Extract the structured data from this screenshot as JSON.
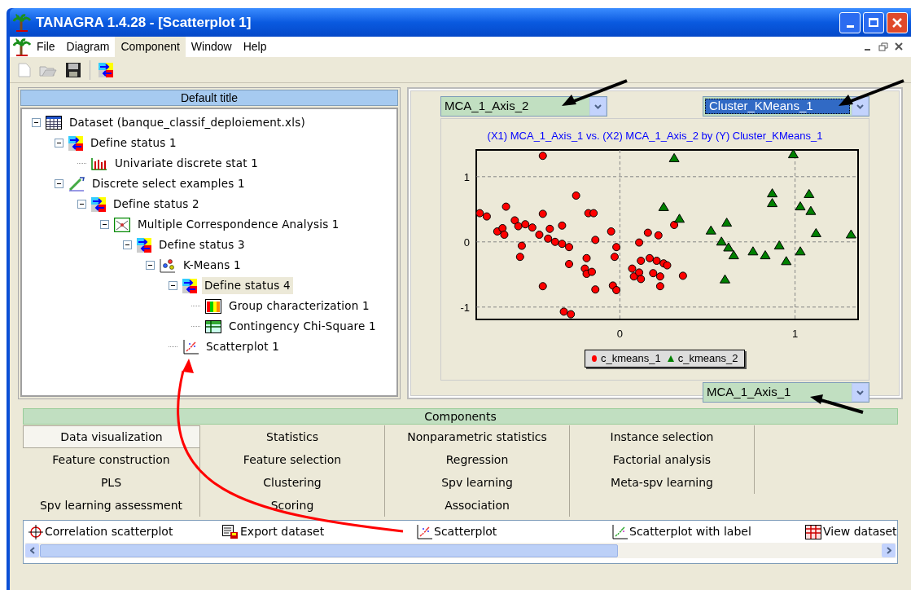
{
  "window": {
    "title": "TANAGRA 1.4.28 - [Scatterplot 1]"
  },
  "menu": [
    {
      "label": "File",
      "selected": false
    },
    {
      "label": "Diagram",
      "selected": false
    },
    {
      "label": "Component",
      "selected": true
    },
    {
      "label": "Window",
      "selected": false
    },
    {
      "label": "Help",
      "selected": false
    }
  ],
  "diagram": {
    "title": "Default title",
    "tree": [
      {
        "label": "Dataset (banque_classif_deploiement.xls)",
        "kind": "table",
        "expanded": true,
        "selected": false,
        "children": [
          {
            "label": "Define status 1",
            "kind": "status",
            "expanded": true,
            "selected": false,
            "children": [
              {
                "label": "Univariate discrete stat 1",
                "kind": "bars",
                "selected": false
              }
            ]
          },
          {
            "label": "Discrete select examples 1",
            "kind": "pen",
            "expanded": true,
            "selected": false,
            "children": [
              {
                "label": "Define status 2",
                "kind": "status",
                "expanded": true,
                "selected": false,
                "children": [
                  {
                    "label": "Multiple Correspondence Analysis 1",
                    "kind": "mca",
                    "expanded": true,
                    "selected": false,
                    "children": [
                      {
                        "label": "Define status 3",
                        "kind": "status",
                        "expanded": true,
                        "selected": false,
                        "children": [
                          {
                            "label": "K-Means 1",
                            "kind": "kmeans",
                            "expanded": true,
                            "selected": false,
                            "children": [
                              {
                                "label": "Define status 4",
                                "kind": "status",
                                "expanded": true,
                                "selected": true,
                                "children": [
                                  {
                                    "label": "Group characterization 1",
                                    "kind": "colors",
                                    "selected": false
                                  },
                                  {
                                    "label": "Contingency Chi-Square 1",
                                    "kind": "grid",
                                    "selected": false
                                  }
                                ]
                              },
                              {
                                "label": "Scatterplot 1",
                                "kind": "scatter",
                                "selected": false
                              }
                            ]
                          }
                        ]
                      }
                    ]
                  }
                ]
              }
            ]
          }
        ]
      }
    ]
  },
  "scatter_view": {
    "y_axis_combo": "MCA_1_Axis_2",
    "class_combo": "Cluster_KMeans_1",
    "x_axis_combo": "MCA_1_Axis_1",
    "chart_data": {
      "type": "scatter",
      "grid": true,
      "title": "(X1) MCA_1_Axis_1 vs. (X2) MCA_1_Axis_2 by (Y) Cluster_KMeans_1",
      "xlim": [
        -0.82,
        1.36
      ],
      "ylim": [
        -1.19,
        1.41
      ],
      "xticks": [
        {
          "value": 0,
          "label": "0"
        },
        {
          "value": 1,
          "label": "1"
        }
      ],
      "yticks": [
        {
          "value": -1,
          "label": "-1"
        },
        {
          "value": 0,
          "label": "0"
        },
        {
          "value": 1,
          "label": "1"
        }
      ],
      "series": [
        {
          "name": "c_kmeans_1",
          "color": "#ff0000",
          "x": [
            -0.8,
            -0.76,
            -0.65,
            -0.7,
            -0.67,
            -0.66,
            -0.6,
            -0.58,
            -0.54,
            -0.5,
            -0.46,
            -0.44,
            -0.44,
            -0.4,
            -0.41,
            -0.37,
            -0.33,
            -0.33,
            -0.29,
            -0.29,
            -0.25,
            -0.56,
            -0.57,
            -0.44,
            -0.32,
            -0.28,
            -0.19,
            -0.2,
            -0.19,
            -0.16,
            -0.18,
            -0.15,
            -0.14,
            -0.14,
            -0.05,
            -0.02,
            -0.03,
            -0.04,
            -0.02,
            0.07,
            0.08,
            0.11,
            0.12,
            0.11,
            0.12,
            0.16,
            0.17,
            0.22,
            0.21,
            0.19,
            0.23,
            0.23,
            0.25,
            0.27,
            0.31,
            0.36
          ],
          "values": [
            0.44,
            0.39,
            0.54,
            0.16,
            0.21,
            0.11,
            0.33,
            0.24,
            0.27,
            0.22,
            0.11,
            1.32,
            0.43,
            0.2,
            0.05,
            0,
            0.25,
            -0.03,
            -0.08,
            -0.34,
            0.71,
            -0.06,
            -0.23,
            -0.68,
            -1.07,
            -1.11,
            -0.25,
            -0.41,
            -0.49,
            -0.46,
            0.44,
            0.44,
            0.03,
            -0.73,
            0.16,
            -0.08,
            -0.23,
            -0.67,
            -0.74,
            -0.41,
            -0.53,
            -0.47,
            -0.57,
            -0.01,
            -0.29,
            0.14,
            -0.25,
            0.1,
            -0.29,
            -0.48,
            -0.53,
            -0.68,
            -0.33,
            -0.36,
            0.26,
            -0.52
          ]
        },
        {
          "name": "c_kmeans_2",
          "color": "#008000",
          "x": [
            0.31,
            0.25,
            0.34,
            0.52,
            0.61,
            0.58,
            0.62,
            0.65,
            0.6,
            0.76,
            0.83,
            0.87,
            0.87,
            0.91,
            0.95,
            0.99,
            1.03,
            1.08,
            1.09,
            1.12,
            1.03,
            1.32
          ],
          "values": [
            1.28,
            0.53,
            0.35,
            0.17,
            0.29,
            0,
            -0.09,
            -0.21,
            -0.58,
            -0.15,
            -0.21,
            0.74,
            0.59,
            -0.06,
            -0.3,
            1.34,
            0.54,
            0.73,
            0.47,
            0.13,
            -0.15,
            0.11
          ]
        }
      ]
    }
  },
  "components": {
    "title": "Components",
    "tabs": [
      {
        "label": "Data visualization",
        "selected": true
      },
      {
        "label": "Statistics",
        "selected": false
      },
      {
        "label": "Nonparametric statistics",
        "selected": false
      },
      {
        "label": "Instance selection",
        "selected": false
      },
      {
        "label": "Feature construction",
        "selected": false
      },
      {
        "label": "Feature selection",
        "selected": false
      },
      {
        "label": "Regression",
        "selected": false
      },
      {
        "label": "Factorial analysis",
        "selected": false
      },
      {
        "label": "PLS",
        "selected": false
      },
      {
        "label": "Clustering",
        "selected": false
      },
      {
        "label": "Spv learning",
        "selected": false
      },
      {
        "label": "Meta-spv learning",
        "selected": false
      },
      {
        "label": "Spv learning assessment",
        "selected": false
      },
      {
        "label": "Scoring",
        "selected": false
      },
      {
        "label": "Association",
        "selected": false
      }
    ],
    "items": [
      {
        "label": "Correlation scatterplot",
        "kind": "crosshair"
      },
      {
        "label": "Export dataset",
        "kind": "export"
      },
      {
        "label": "Scatterplot",
        "kind": "scatter"
      },
      {
        "label": "Scatterplot with label",
        "kind": "scatter-green"
      },
      {
        "label": "View dataset",
        "kind": "view"
      }
    ]
  }
}
